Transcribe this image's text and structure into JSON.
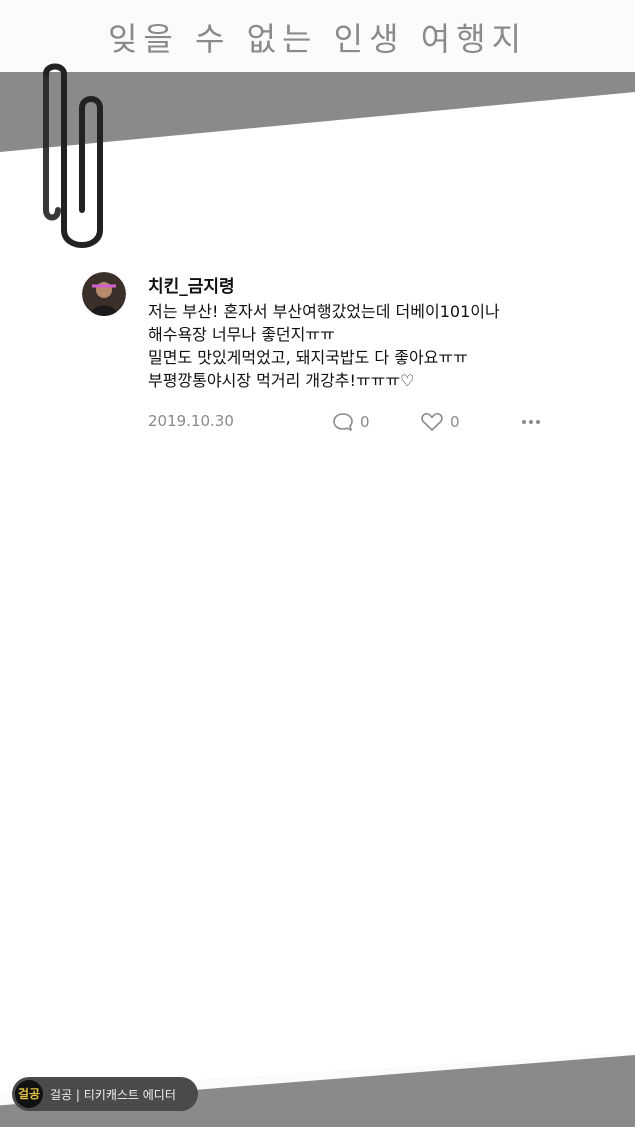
{
  "page": {
    "title": "잊을 수 없는 인생 여행지"
  },
  "post": {
    "username": "치킨_금지령",
    "lines": [
      "저는 부산! 혼자서 부산여행갔었는데 더베이101이나",
      "해수욕장 너무나 좋던지ㅠㅠ",
      "밀면도 맛있게먹었고, 돼지국밥도 다 좋아요ㅠㅠ",
      "부평깡통야시장 먹거리 개강추!ㅠㅠㅠ♡"
    ],
    "date": "2019.10.30",
    "reply_count": "0",
    "like_count": "0"
  },
  "badge": {
    "logo": "걸공",
    "text": "걸공 | 티키캐스트 에디터"
  },
  "icons": {
    "reply": "speech-bubble-icon",
    "like": "heart-icon",
    "more": "more-dots-icon",
    "clip": "paperclip-icon"
  },
  "colors": {
    "tape": "#8a8a8a",
    "meta_text": "#8a8a8a",
    "body_text": "#111111"
  }
}
